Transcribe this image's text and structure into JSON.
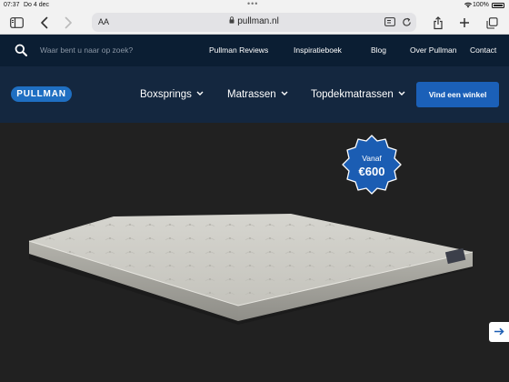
{
  "status_bar": {
    "time": "07:37",
    "date": "Do 4 dec",
    "battery_pct": "100%"
  },
  "browser": {
    "aa_label": "AA",
    "url": "pullman.nl",
    "icons": [
      "sidebar-icon",
      "back-icon",
      "forward-icon",
      "lock-icon",
      "reader-icon",
      "reload-icon",
      "share-icon",
      "new-tab-icon",
      "tabs-icon"
    ]
  },
  "top_nav": {
    "search_placeholder": "Waar bent u naar op zoek?",
    "links": [
      "Pullman Reviews",
      "Inspiratieboek",
      "Blog",
      "Over Pullman",
      "Contact"
    ]
  },
  "main_nav": {
    "logo": "PULLMAN",
    "menu": [
      "Boxsprings",
      "Matrassen",
      "Topdekmatrassen"
    ],
    "cta": "Vind een winkel"
  },
  "hero": {
    "badge_label": "Vanaf",
    "badge_price": "€600"
  },
  "colors": {
    "nav_dark": "#0b1e33",
    "nav_main": "#14273f",
    "brand_blue": "#1b60b8",
    "hero_bg": "#212121"
  }
}
